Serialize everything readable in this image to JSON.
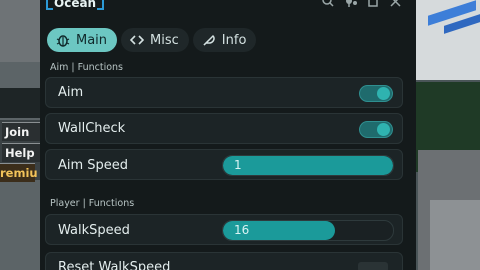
{
  "game_buttons": {
    "join": "Join",
    "help": "Help",
    "premium": "remiu"
  },
  "window": {
    "title": "Ocean",
    "icons": [
      "search-icon",
      "pin-icon",
      "restore-icon",
      "close-icon"
    ]
  },
  "tabs": [
    {
      "label": "Main",
      "icon": "bug-icon",
      "active": true
    },
    {
      "label": "Misc",
      "icon": "code-icon",
      "active": false
    },
    {
      "label": "Info",
      "icon": "feather-icon",
      "active": false
    }
  ],
  "sections": {
    "aim": "Aim | Functions",
    "player": "Player | Functions"
  },
  "aim": {
    "aim": {
      "label": "Aim",
      "enabled": true
    },
    "wallcheck": {
      "label": "WallCheck",
      "enabled": true
    },
    "aim_speed": {
      "label": "Aim Speed",
      "value": "1",
      "fill": 1.0
    }
  },
  "player": {
    "walkspeed": {
      "label": "WalkSpeed",
      "value": "16",
      "fill": 0.66
    },
    "reset_walkspeed": {
      "label": "Reset WalkSpeed"
    }
  },
  "colors": {
    "accent": "#6cc7c2",
    "slider": "#1b9a9a",
    "panel": "#141a1b"
  }
}
